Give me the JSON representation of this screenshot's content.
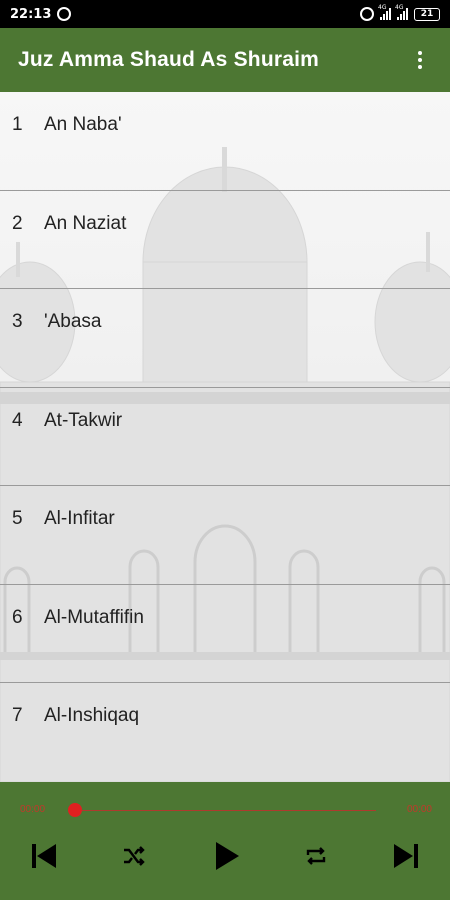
{
  "status_bar": {
    "time": "22:13",
    "battery": "21",
    "network_tags": [
      "4G",
      "4G"
    ]
  },
  "app_bar": {
    "title": "Juz Amma Shaud As Shuraim",
    "menu_icon": "overflow-menu-icon"
  },
  "surahs": [
    {
      "number": "1",
      "name": "An Naba'"
    },
    {
      "number": "2",
      "name": "An Naziat"
    },
    {
      "number": "3",
      "name": "'Abasa"
    },
    {
      "number": "4",
      "name": "At-Takwir"
    },
    {
      "number": "5",
      "name": "Al-Infitar"
    },
    {
      "number": "6",
      "name": "Al-Mutaffifin"
    },
    {
      "number": "7",
      "name": "Al-Inshiqaq"
    }
  ],
  "player": {
    "current_time": "00:00",
    "total_time": "00:00",
    "progress": 0,
    "controls": [
      "previous-icon",
      "shuffle-icon",
      "play-icon",
      "repeat-icon",
      "next-icon"
    ]
  },
  "colors": {
    "primary": "#4d7733",
    "seek_accent": "#e02020",
    "time_text": "#c0392b"
  }
}
